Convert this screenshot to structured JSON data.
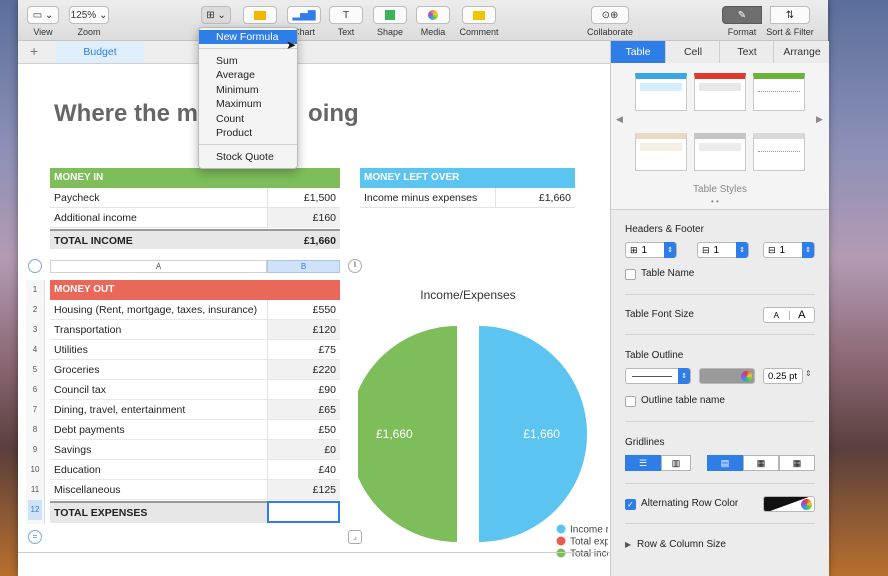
{
  "toolbar": {
    "view_label": "View",
    "zoom_value": "125%",
    "zoom_label": "Zoom",
    "chart_label": "Chart",
    "text_label": "Text",
    "shape_label": "Shape",
    "media_label": "Media",
    "comment_label": "Comment",
    "collaborate_label": "Collaborate",
    "format_label": "Format",
    "sort_filter_label": "Sort & Filter"
  },
  "sheet": {
    "add_label": "+",
    "tab_label": "Budget"
  },
  "formula_menu": {
    "items": [
      "New Formula",
      "Sum",
      "Average",
      "Minimum",
      "Maximum",
      "Count",
      "Product",
      "Stock Quote"
    ],
    "selected": "New Formula"
  },
  "document": {
    "title": "Where the m",
    "title_tail": "oing"
  },
  "money_in": {
    "header": "MONEY IN",
    "rows": [
      {
        "label": "Paycheck",
        "value": "£1,500"
      },
      {
        "label": "Additional income",
        "value": "£160"
      }
    ],
    "total_label": "TOTAL INCOME",
    "total_value": "£1,660"
  },
  "money_left": {
    "header": "MONEY LEFT OVER",
    "label": "Income minus expenses",
    "value": "£1,660"
  },
  "column_headers": [
    "A",
    "B"
  ],
  "money_out": {
    "header": "MONEY OUT",
    "row_numbers": [
      "1",
      "2",
      "3",
      "4",
      "5",
      "6",
      "7",
      "8",
      "9",
      "10",
      "11",
      "12"
    ],
    "rows": [
      {
        "label": "Housing (Rent, mortgage, taxes, insurance)",
        "value": "£550"
      },
      {
        "label": "Transportation",
        "value": "£120"
      },
      {
        "label": "Utilities",
        "value": "£75"
      },
      {
        "label": "Groceries",
        "value": "£220"
      },
      {
        "label": "Council tax",
        "value": "£90"
      },
      {
        "label": "Dining, travel, entertainment",
        "value": "£65"
      },
      {
        "label": "Debt payments",
        "value": "£50"
      },
      {
        "label": "Savings",
        "value": "£0"
      },
      {
        "label": "Education",
        "value": "£40"
      },
      {
        "label": "Miscellaneous",
        "value": "£125"
      }
    ],
    "total_label": "TOTAL EXPENSES",
    "total_value": ""
  },
  "chart_data": {
    "type": "pie",
    "title": "Income/Expenses",
    "slices": [
      {
        "name": "Income minus expenses",
        "value": 1660,
        "label": "£1,660",
        "color": "#5bc4f0"
      },
      {
        "name": "Total expenses",
        "value": 0,
        "label": "",
        "color": "#e95b4f"
      },
      {
        "name": "Total income",
        "value": 1660,
        "label": "£1,660",
        "color": "#7dbd5a"
      }
    ],
    "legend_visible": [
      "Income r",
      "Total exp",
      "Total inco"
    ],
    "legend_position": "bottom-right"
  },
  "inspector": {
    "tabs": [
      "Table",
      "Cell",
      "Text",
      "Arrange"
    ],
    "active_tab": "Table",
    "table_styles_label": "Table Styles",
    "headers_footer_label": "Headers & Footer",
    "header_rows": "1",
    "header_cols": "1",
    "footer_rows": "1",
    "table_name_label": "Table Name",
    "font_size_label": "Table Font Size",
    "font_small": "A",
    "font_large": "A",
    "outline_label": "Table Outline",
    "outline_width": "0.25 pt",
    "outline_name_label": "Outline table name",
    "gridlines_label": "Gridlines",
    "alternating_label": "Alternating Row Color",
    "row_col_size_label": "Row & Column Size",
    "colors": {
      "accent": "#2f7ee7",
      "green": "#7dbd5a",
      "red": "#e9685a",
      "blue": "#5bc4f0"
    }
  }
}
